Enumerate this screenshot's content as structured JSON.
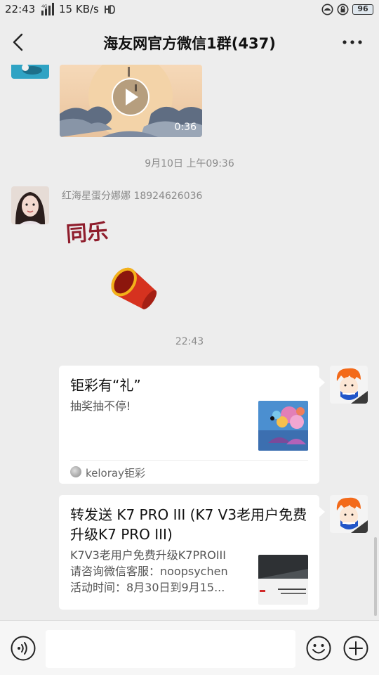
{
  "status_bar": {
    "time": "22:43",
    "network_speed": "15 KB/s",
    "battery": "96"
  },
  "nav": {
    "title": "海友网官方微信1群(437)"
  },
  "video_message": {
    "duration": "0:36"
  },
  "timestamps": {
    "first": "9月10日 上午09:36",
    "second": "22:43"
  },
  "sticker_message": {
    "sender": "红海星蛋分娜娜 18924626036",
    "sticker_text": "同乐"
  },
  "link_cards": [
    {
      "title": "钜彩有“礼”",
      "description": "抽奖抽不停!",
      "source": "keloray钜彩"
    },
    {
      "title": "转发送 K7 PRO III (K7 V3老用户免费升级K7 PRO III)",
      "description_lines": [
        "K7V3老用户免费升级K7PROIII",
        "请咨询微信客服：noopsychen",
        "活动时间：8月30日到9月15..."
      ]
    }
  ],
  "colors": {
    "background": "#ededed",
    "card": "#ffffff",
    "meta_text": "#8a8a8a"
  }
}
